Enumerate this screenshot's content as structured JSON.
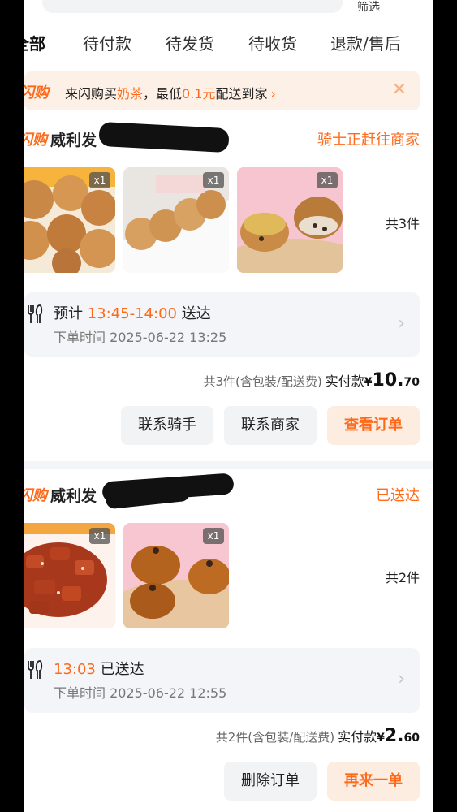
{
  "filter_label": "筛选",
  "tabs": [
    "全部",
    "待付款",
    "待发货",
    "待收货",
    "退款/售后"
  ],
  "promo": {
    "logo": "闪购",
    "text_a": "来闪购买",
    "text_b": "奶茶",
    "text_c": "，最低",
    "text_d": "0.1元",
    "text_e": "配送到家",
    "arrow": "›",
    "close": "✕"
  },
  "orders": [
    {
      "logo": "闪购",
      "shop": "威利发",
      "status": "骑士正赶往商家",
      "items": [
        {
          "qty": "x1"
        },
        {
          "qty": "x1"
        },
        {
          "qty": "x1"
        }
      ],
      "count": "共3件",
      "eta_prefix": "预计 ",
      "eta_time": "13:45-14:00",
      "eta_suffix": " 送达",
      "order_time": "下单时间 2025-06-22 13:25",
      "total_text": "共3件(含包装/配送费)",
      "pay_label": "实付款",
      "currency": "¥",
      "amount_int": "10.",
      "amount_dec": "70",
      "buttons": [
        "联系骑手",
        "联系商家",
        "查看订单"
      ]
    },
    {
      "logo": "闪购",
      "shop": "威利发",
      "status": "已送达",
      "items": [
        {
          "qty": "x1"
        },
        {
          "qty": "x1"
        }
      ],
      "count": "共2件",
      "eta_prefix": "",
      "eta_time": "13:03",
      "eta_suffix": " 已送达",
      "order_time": "下单时间 2025-06-22 12:55",
      "total_text": "共2件(含包装/配送费)",
      "pay_label": "实付款",
      "currency": "¥",
      "amount_int": "2.",
      "amount_dec": "60",
      "buttons": [
        "删除订单",
        "再来一单"
      ]
    }
  ],
  "colors": {
    "accent": "#ff6a1a",
    "promo_bg": "#fdf0e6",
    "card_bg": "#f4f5f8"
  }
}
